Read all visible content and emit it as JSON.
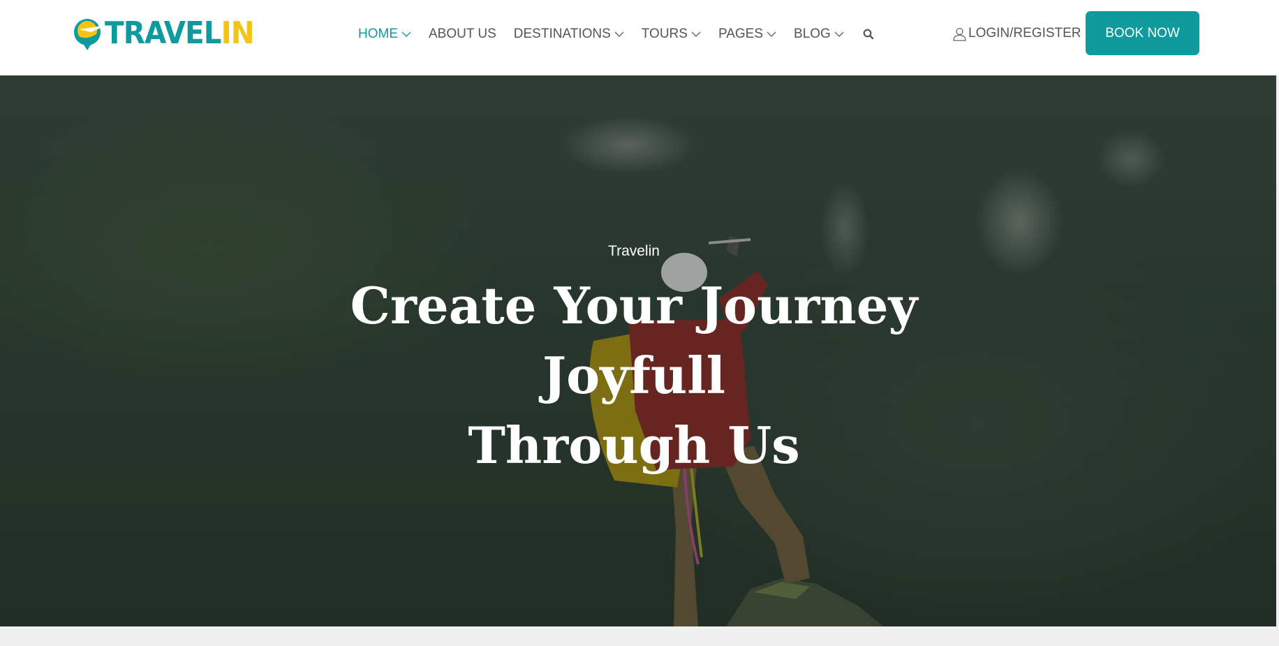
{
  "brand": {
    "logo_text_part1": "TRAVEL",
    "logo_text_part2": "IN",
    "primary_color": "#0f9a9e",
    "accent_color": "#f3c316"
  },
  "nav": {
    "items": [
      {
        "label": "HOME",
        "has_dropdown": true,
        "active": true
      },
      {
        "label": "ABOUT US",
        "has_dropdown": false,
        "active": false
      },
      {
        "label": "DESTINATIONS",
        "has_dropdown": true,
        "active": false
      },
      {
        "label": "TOURS",
        "has_dropdown": true,
        "active": false
      },
      {
        "label": "PAGES",
        "has_dropdown": true,
        "active": false
      },
      {
        "label": "BLOG",
        "has_dropdown": true,
        "active": false
      }
    ],
    "search_icon": "search-icon"
  },
  "header_actions": {
    "login_label": "LOGIN/REGISTER",
    "login_icon": "user-icon",
    "book_label": "BOOK NOW"
  },
  "hero": {
    "kicker": "Travelin",
    "title_line1": "Create Your Journey Joyfull",
    "title_line2": "Through Us"
  }
}
